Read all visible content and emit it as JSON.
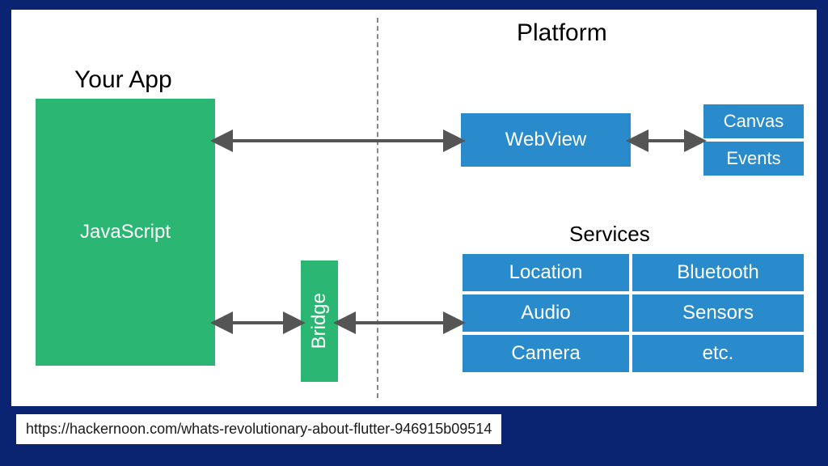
{
  "labels": {
    "your_app": "Your App",
    "platform": "Platform",
    "services": "Services"
  },
  "boxes": {
    "javascript": "JavaScript",
    "bridge": "Bridge",
    "webview": "WebView",
    "canvas": "Canvas",
    "events": "Events",
    "location": "Location",
    "bluetooth": "Bluetooth",
    "audio": "Audio",
    "sensors": "Sensors",
    "camera": "Camera",
    "etc": "etc."
  },
  "source_url": "https://hackernoon.com/whats-revolutionary-about-flutter-946915b09514",
  "colors": {
    "green": "#2bb673",
    "blue": "#2a8bcc",
    "bg": "#0a2472"
  }
}
